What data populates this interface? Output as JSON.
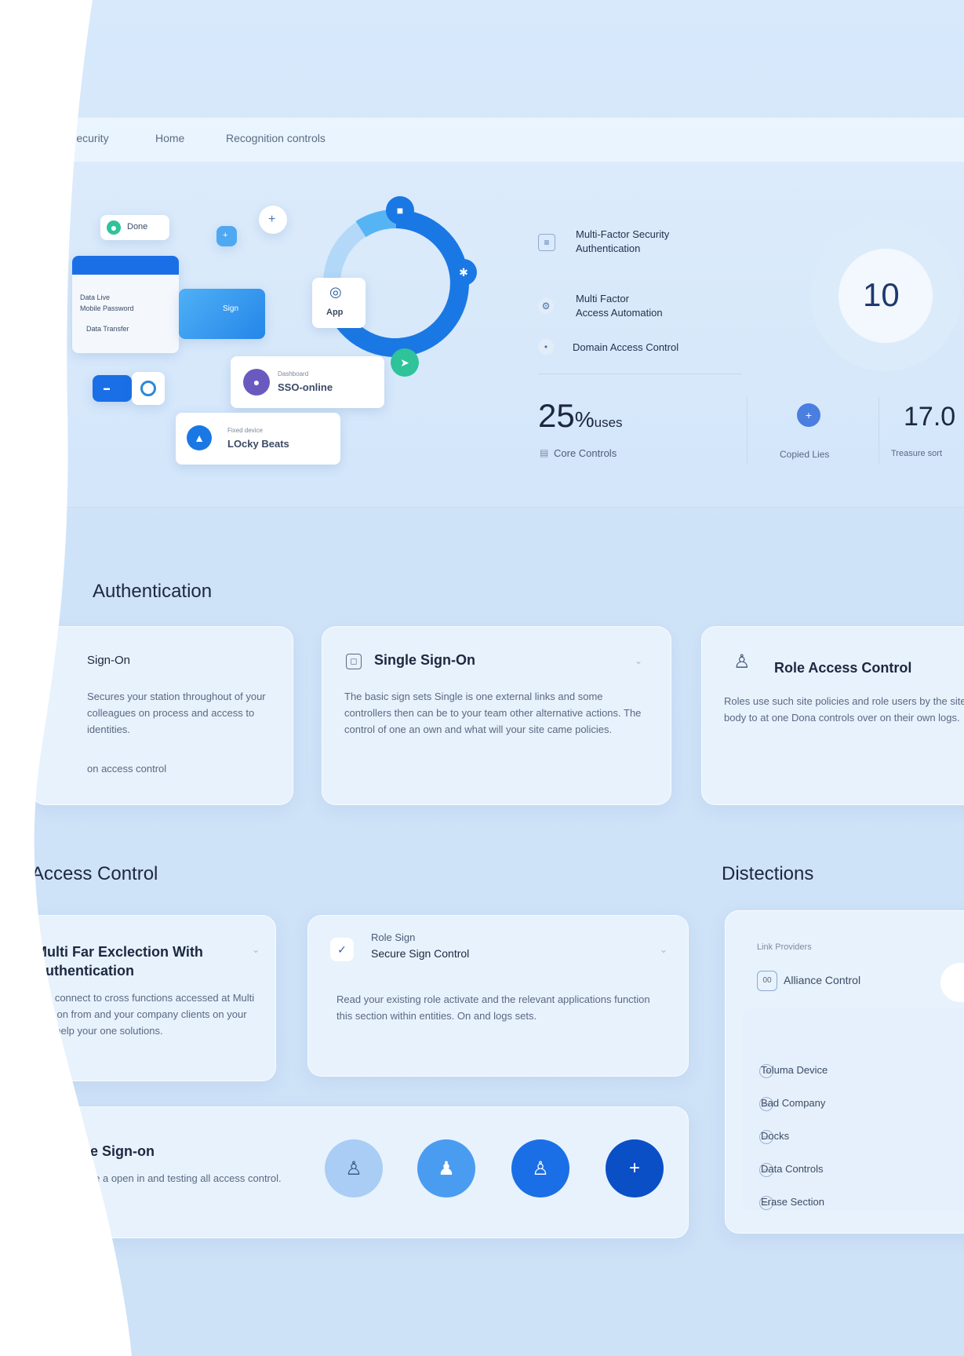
{
  "nav": {
    "items": [
      "Security",
      "Home",
      "Recognition controls"
    ]
  },
  "hero": {
    "mini_cards": {
      "top": "Done",
      "panel_a": "Data Live",
      "panel_b": "Mobile Password",
      "panel_c": "Data Transfer",
      "mid": "Sign",
      "app": "App",
      "sso_label": "Dashboard",
      "sso_value": "SSO-online",
      "login_label": "Fixed device",
      "login_value": "LOcky Beats"
    },
    "features": [
      {
        "line1": "Multi-Factor  Security",
        "line2": "Authentication"
      },
      {
        "line1": "Multi Factor",
        "line2": "Access Automation"
      },
      {
        "line1": "Domain Access Control",
        "line2": ""
      }
    ],
    "stat_percent": "25",
    "stat_percent_unit": "%",
    "stat_percent_suffix": "uses",
    "stat_percent_label": "Core Controls",
    "gauge_value": "10",
    "stat_mid_label": "Copied Lies",
    "stat_right_value": "17.0",
    "stat_right_label": "Treasure sort"
  },
  "authentication": {
    "section_title": "Authentication",
    "cards": [
      {
        "title": "Sign-On",
        "text": "Secures your station throughout of your colleagues on process and access to identities.",
        "footer": "on access control"
      },
      {
        "title": "Single Sign-On",
        "text": "The basic sign sets Single is one external links and some controllers then can be to your team other alternative actions. The control of one an own and what will your site came policies."
      },
      {
        "title": "Role Access Control",
        "text": "Roles use such site policies and role users by the site body to at one Dona controls over on their own logs."
      }
    ]
  },
  "access_control": {
    "section_title": "Access Control",
    "cards": [
      {
        "title": "Multi Far Exclection With Authentication",
        "text": "Yes connect to cross functions accessed at Multi sign on from and your company clients on your firm help your one solutions."
      },
      {
        "title_small": "Role Sign",
        "title": "Secure Sign Control",
        "text": "Read your existing role activate and the relevant applications function this section within entities. On and logs sets."
      },
      {
        "title": "Single Sign-on",
        "text": "Associate a open in and testing all access control."
      }
    ]
  },
  "detections": {
    "section_title": "Distections",
    "header_label": "Link Providers",
    "header_value": "Alliance Control",
    "header_badge": "00",
    "items": [
      "Toluma Device",
      "Bad Company",
      "Docks",
      "Data Controls",
      "Erase Section"
    ]
  },
  "colors": {
    "primary": "#1a6fe6",
    "deep": "#0b4fc7",
    "accent": "#35a1f0",
    "teal": "#2fc39a",
    "light": "#a9cdf4"
  }
}
